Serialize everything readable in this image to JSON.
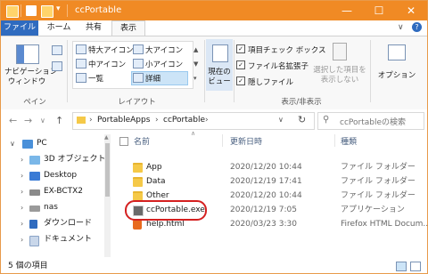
{
  "titlebar": {
    "title": "ccPortable",
    "accent": "#f08a24"
  },
  "tabs": {
    "file": "ファイル",
    "home": "ホーム",
    "share": "共有",
    "view": "表示"
  },
  "ribbon": {
    "nav_pane": "ナビゲーション\nウィンドウ",
    "pane_group": "ペイン",
    "layout": {
      "xl_icons": "特大アイコン",
      "l_icons": "大アイコン",
      "m_icons": "中アイコン",
      "s_icons": "小アイコン",
      "list": "一覧",
      "details": "詳細",
      "group": "レイアウト"
    },
    "current_view": "現在の\nビュー",
    "checks": {
      "item_check": "項目チェック ボックス",
      "ext": "ファイル名拡張子",
      "hidden": "隠しファイル"
    },
    "hide_selected": "選択した項目を\n表示しない",
    "options": "オプション",
    "show_hide_group": "表示/非表示"
  },
  "address": {
    "crumbs": [
      "PortableApps",
      "ccPortable"
    ],
    "search_placeholder": "ccPortableの検索"
  },
  "tree": [
    {
      "label": "PC",
      "icon": "pc-icon",
      "expanded": true
    },
    {
      "label": "3D オブジェクト",
      "icon": "3d-objects-icon"
    },
    {
      "label": "Desktop",
      "icon": "desktop-icon"
    },
    {
      "label": "EX-BCTX2",
      "icon": "drive-icon"
    },
    {
      "label": "nas",
      "icon": "network-drive-icon"
    },
    {
      "label": "ダウンロード",
      "icon": "download-icon"
    },
    {
      "label": "ドキュメント",
      "icon": "documents-icon"
    }
  ],
  "columns": {
    "name": "名前",
    "date": "更新日時",
    "type": "種類"
  },
  "files": [
    {
      "name": "App",
      "date": "2020/12/20 10:44",
      "type": "ファイル フォルダー",
      "icon": "folder-icon"
    },
    {
      "name": "Data",
      "date": "2020/12/19 17:41",
      "type": "ファイル フォルダー",
      "icon": "folder-icon"
    },
    {
      "name": "Other",
      "date": "2020/12/20 10:44",
      "type": "ファイル フォルダー",
      "icon": "folder-icon"
    },
    {
      "name": "ccPortable.exe",
      "date": "2020/12/19 7:05",
      "type": "アプリケーション",
      "icon": "exe-icon"
    },
    {
      "name": "help.html",
      "date": "2020/03/23 3:30",
      "type": "Firefox HTML Docum...",
      "icon": "html-icon"
    }
  ],
  "status": {
    "count": "5 個の項目"
  },
  "colors": {
    "highlight_oval": "#d42020",
    "file_tab": "#2f6bbf"
  }
}
